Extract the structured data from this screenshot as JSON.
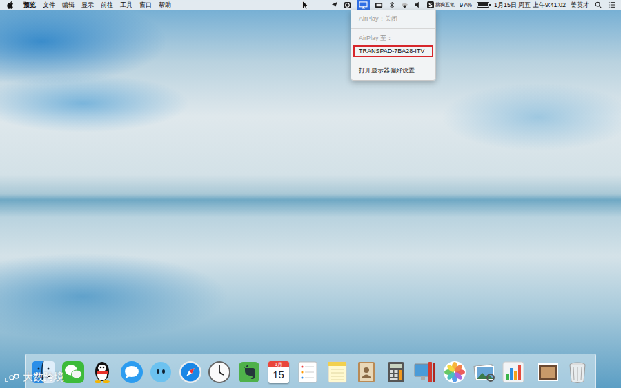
{
  "menu_bar": {
    "app_menus": [
      {
        "label": "预览",
        "bold": true
      },
      {
        "label": "文件",
        "bold": false
      },
      {
        "label": "编辑",
        "bold": false
      },
      {
        "label": "显示",
        "bold": false
      },
      {
        "label": "前往",
        "bold": false
      },
      {
        "label": "工具",
        "bold": false
      },
      {
        "label": "窗口",
        "bold": false
      },
      {
        "label": "帮助",
        "bold": false
      }
    ],
    "status": {
      "airplay_open": true,
      "input_method": "搜狗五笔",
      "battery_percent": "97%",
      "battery_level": 0.97,
      "clock": "1月15日 周五 上午9:41:02",
      "user": "姜英才"
    }
  },
  "airplay_menu": {
    "items": [
      {
        "label": "AirPlay：关闭",
        "disabled": true,
        "outlined": false,
        "separator_after": true
      },
      {
        "label": "AirPlay 至：",
        "disabled": true,
        "outlined": false,
        "separator_after": false
      },
      {
        "label": "TRANSPAD-7BA28-ITV",
        "disabled": false,
        "outlined": true,
        "separator_after": true
      },
      {
        "label": "打开显示器偏好设置…",
        "disabled": false,
        "outlined": false,
        "separator_after": false
      }
    ]
  },
  "dock": {
    "calendar_month": "1月",
    "calendar_day": "15"
  },
  "watermark": {
    "text": "大数跨境"
  }
}
